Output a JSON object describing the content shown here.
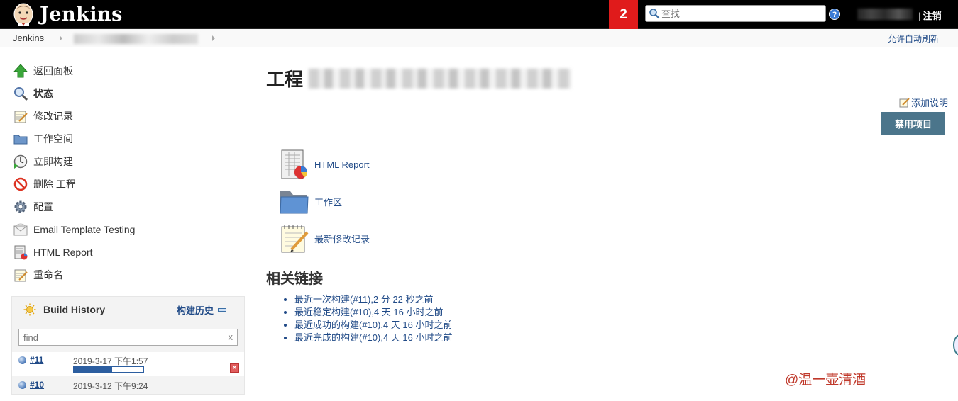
{
  "header": {
    "logo_text": "Jenkins",
    "notification_count": "2",
    "search_placeholder": "查找",
    "help_glyph": "?",
    "logout_label": "注销"
  },
  "breadcrumb": {
    "root": "Jenkins",
    "auto_refresh": "允许自动刷新"
  },
  "sidebar": {
    "items": [
      {
        "label": "返回面板",
        "icon": "up-arrow-icon"
      },
      {
        "label": "状态",
        "icon": "magnifier-icon"
      },
      {
        "label": "修改记录",
        "icon": "notepad-icon"
      },
      {
        "label": "工作空间",
        "icon": "folder-icon"
      },
      {
        "label": "立即构建",
        "icon": "clock-icon"
      },
      {
        "label": "删除 工程",
        "icon": "no-entry-icon"
      },
      {
        "label": "配置",
        "icon": "gear-icon"
      },
      {
        "label": "Email Template Testing",
        "icon": "envelope-icon"
      },
      {
        "label": "HTML Report",
        "icon": "report-icon"
      },
      {
        "label": "重命名",
        "icon": "notepad-icon"
      }
    ]
  },
  "build_history": {
    "title": "Build History",
    "trend_label": "构建历史",
    "filter_placeholder": "find",
    "clear_glyph": "x",
    "builds": [
      {
        "number": "#11",
        "date": "2019-3-17 下午1:57",
        "progress": 0.55,
        "running": true
      },
      {
        "number": "#10",
        "date": "2019-3-12 下午9:24",
        "running": false
      }
    ]
  },
  "main": {
    "title_prefix": "工程",
    "add_description": "添加说明",
    "disable_button": "禁用项目",
    "links": [
      {
        "label": "HTML Report",
        "icon": "report-icon"
      },
      {
        "label": "工作区",
        "icon": "folder-icon"
      },
      {
        "label": "最新修改记录",
        "icon": "notepad-icon"
      }
    ],
    "related_title": "相关链接",
    "related_links": [
      "最近一次构建(#11),2 分 22 秒之前",
      "最近稳定构建(#10),4 天 16 小时之前",
      "最近成功的构建(#10),4 天 16 小时之前",
      "最近完成的构建(#10),4 天 16 小时之前"
    ]
  },
  "watermark": "@温一壶清酒",
  "colors": {
    "header_bg": "#000000",
    "notification_bg": "#e01b1b",
    "link": "#204a87",
    "disable_button_bg": "#4b758b",
    "watermark": "#c0392b"
  }
}
